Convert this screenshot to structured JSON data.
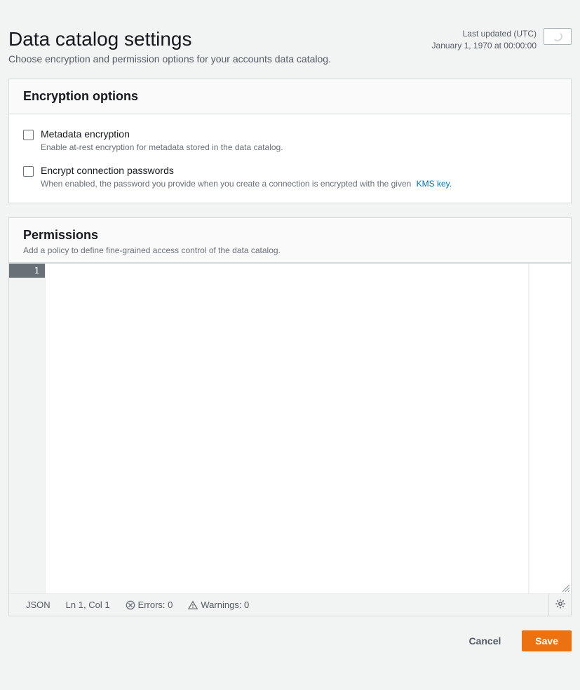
{
  "header": {
    "title": "Data catalog settings",
    "subtitle": "Choose encryption and permission options for your accounts data catalog.",
    "last_updated_label": "Last updated (UTC)",
    "last_updated_value": "January 1, 1970 at 00:00:00"
  },
  "encryption": {
    "heading": "Encryption options",
    "options": [
      {
        "label": "Metadata encryption",
        "desc": "Enable at-rest encryption for metadata stored in the data catalog."
      },
      {
        "label": "Encrypt connection passwords",
        "desc": "When enabled, the password you provide when you create a connection is encrypted with the given",
        "link": "KMS key."
      }
    ]
  },
  "permissions": {
    "heading": "Permissions",
    "sub": "Add a policy to define fine-grained access control of the data catalog."
  },
  "editor": {
    "line_number": "1",
    "status": {
      "lang": "JSON",
      "position": "Ln 1, Col 1",
      "errors": "Errors: 0",
      "warnings": "Warnings: 0"
    }
  },
  "actions": {
    "cancel": "Cancel",
    "save": "Save"
  }
}
